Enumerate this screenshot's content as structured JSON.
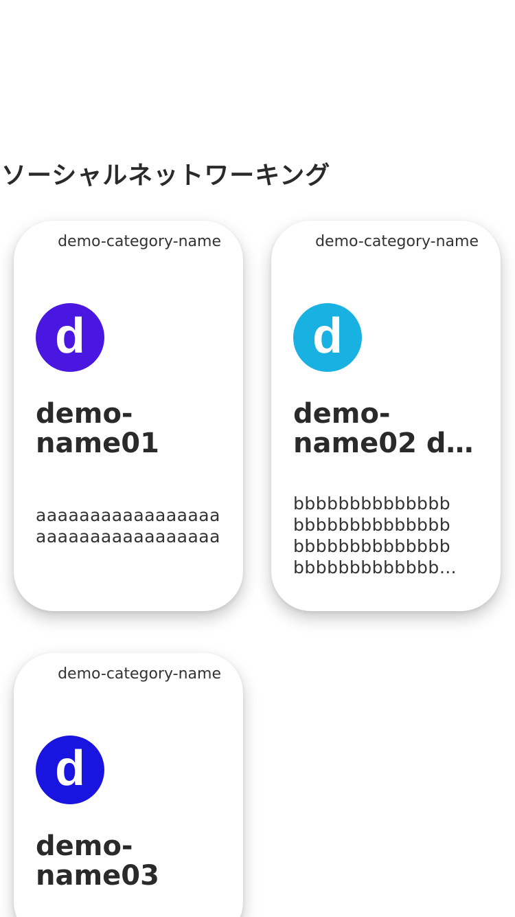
{
  "section": {
    "title": "ソーシャルネットワーキング"
  },
  "cards": [
    {
      "category": "demo-category-name",
      "avatar_letter": "d",
      "avatar_color": "#4a17e0",
      "name": "demo-\nname01",
      "description": "aaaaaaaaaaaaaaaaaaaaaaaaaaaaaaaaaa"
    },
    {
      "category": "demo-category-name",
      "avatar_letter": "d",
      "avatar_color": "#18b1e2",
      "name": "demo-\nname02 d…",
      "description": "bbbbbbbbbbbbbb\nbbbbbbbbbbbbbb\nbbbbbbbbbbbbbb\nbbbbbbbbbbbbb…"
    },
    {
      "category": "demo-category-name",
      "avatar_letter": "d",
      "avatar_color": "#1a14e0",
      "name": "demo-\nname03",
      "description": ""
    }
  ]
}
